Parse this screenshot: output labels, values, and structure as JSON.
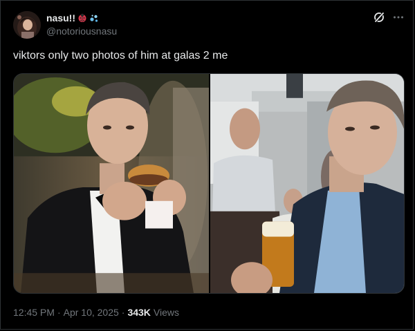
{
  "tweet": {
    "author": {
      "display_name": "nasu!!",
      "handle": "@notoriousnasu",
      "name_emojis": [
        "ladybug-emoji",
        "sparkles-droplets-emoji"
      ]
    },
    "text": "viktors only two photos of him at galas 2 me",
    "media": [
      {
        "kind": "photo",
        "subject": "man in tuxedo eating a burger"
      },
      {
        "kind": "photo",
        "subject": "man holding a glass of beer at an event"
      }
    ],
    "meta": {
      "time": "12:45 PM",
      "separator1": "·",
      "date": "Apr 10, 2025",
      "separator2": "·",
      "views_count": "343K",
      "views_label": "Views"
    }
  },
  "icons": {
    "grok": "grok-icon",
    "more": "more-dots-icon"
  },
  "colors": {
    "background": "#000000",
    "text_primary": "#e7e9ea",
    "text_secondary": "#71767b",
    "border": "#2f3336"
  }
}
